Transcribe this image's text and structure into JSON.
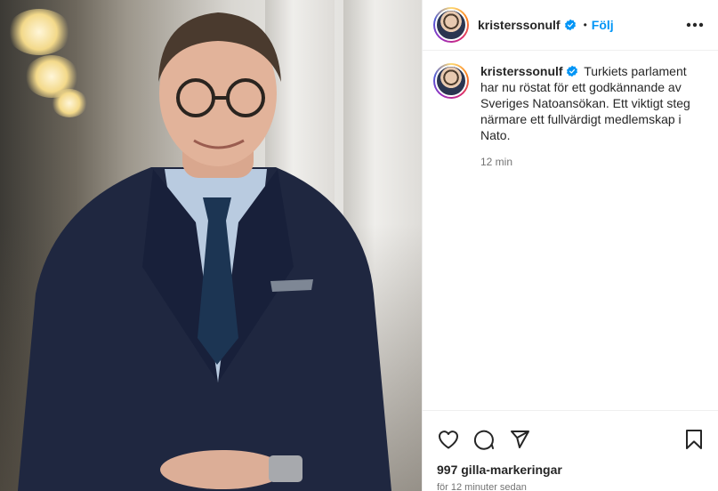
{
  "post": {
    "image": {
      "alt": "",
      "icon": "photo"
    },
    "author": {
      "username": "kristerssonulf",
      "verified_icon": "verified-badge-icon",
      "separator": "•",
      "follow_label": "Följ"
    },
    "more_icon": "more-horizontal-icon",
    "caption": {
      "username": "kristerssonulf",
      "text": "Turkiets parlament har nu röstat för ett godkännande av Sveriges Natoansökan. Ett viktigt steg närmare ett fullvärdigt medlemskap i Nato.",
      "time": "12 min"
    },
    "actions": {
      "like_icon": "heart-icon",
      "comment_icon": "comment-icon",
      "share_icon": "send-icon",
      "save_icon": "bookmark-icon"
    },
    "likes": "997 gilla-markeringar",
    "posted_ago": "för 12 minuter sedan"
  },
  "colors": {
    "accent": "#0095f6",
    "text": "#262626",
    "muted": "#737373",
    "border": "#efefef"
  }
}
